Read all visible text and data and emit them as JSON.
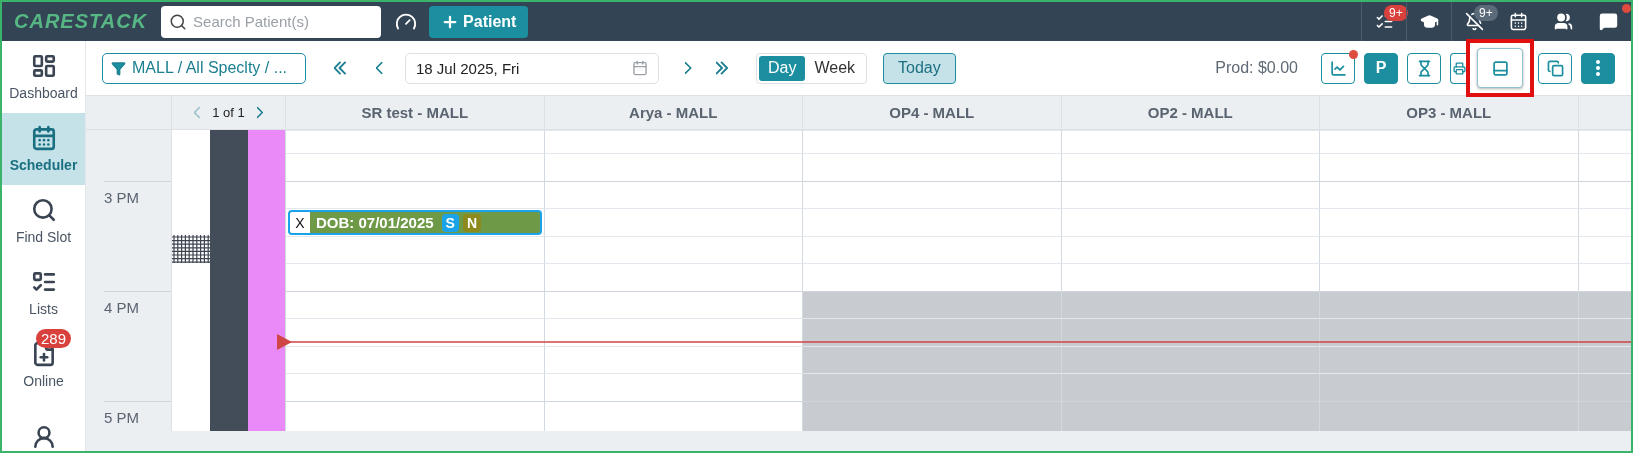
{
  "topbar": {
    "logo": "CARESTACK",
    "search": {
      "placeholder": "Search Patient(s)"
    },
    "add_patient": "Patient",
    "icons": [
      {
        "kind": "tasks",
        "badge": "9+",
        "color": "#d9413d"
      },
      {
        "kind": "learn"
      },
      {
        "kind": "bell-off",
        "badge": "9+",
        "color": "#5c6b7a"
      },
      {
        "kind": "calendar"
      },
      {
        "kind": "users"
      },
      {
        "kind": "chat",
        "dot": true
      }
    ]
  },
  "sidebar": {
    "items": [
      {
        "label": "Dashboard",
        "selected": false
      },
      {
        "label": "Scheduler",
        "selected": true
      },
      {
        "label": "Find Slot",
        "selected": false
      },
      {
        "label": "Lists",
        "selected": false
      },
      {
        "label": "Online",
        "selected": false,
        "badge": "289"
      },
      {
        "selected": false
      }
    ]
  },
  "toolbar": {
    "filter": "MALL / All Speclty / ...",
    "date": "18 Jul 2025, Fri",
    "views": [
      {
        "label": "Day",
        "selected": true
      },
      {
        "label": "Week",
        "selected": false
      }
    ],
    "today": "Today",
    "production": "Prod: $0.00",
    "actions": [
      {
        "kind": "chart",
        "filled": false,
        "dot": true
      },
      {
        "kind": "text",
        "text": "P",
        "filled": true
      },
      {
        "kind": "timer",
        "filled": false
      },
      {
        "kind": "print",
        "filled": false
      },
      {
        "kind": "layout",
        "filled": false,
        "highlighted": true
      },
      {
        "kind": "copy",
        "filled": false
      },
      {
        "kind": "more",
        "filled": true
      }
    ]
  },
  "calendar": {
    "pager": {
      "text": "1 of 1",
      "prev_disabled": true,
      "next_disabled": false
    },
    "columns": [
      {
        "name": "SR test - MALL"
      },
      {
        "name": "Arya - MALL"
      },
      {
        "name": "OP4 - MALL"
      },
      {
        "name": "OP2 - MALL"
      },
      {
        "name": "OP3 - MALL"
      },
      {}
    ],
    "slots": [
      {
        "hour_start": false,
        "cells": [
          {
            "blocked": false
          },
          {
            "blocked": false
          },
          {
            "blocked": false
          },
          {
            "blocked": false
          },
          {
            "blocked": false
          },
          {
            "blocked": false
          }
        ]
      },
      {
        "hour_start": false,
        "cells": [
          {
            "blocked": false
          },
          {
            "blocked": false
          },
          {
            "blocked": false
          },
          {
            "blocked": false
          },
          {
            "blocked": false
          },
          {
            "blocked": false
          }
        ]
      },
      {
        "label": "3 PM",
        "hour_start": true,
        "cells": [
          {
            "blocked": false
          },
          {
            "blocked": false
          },
          {
            "blocked": false
          },
          {
            "blocked": false
          },
          {
            "blocked": false
          },
          {
            "blocked": false
          }
        ]
      },
      {
        "hour_start": false,
        "cells": [
          {
            "blocked": false,
            "appointment": {
              "close": "X",
              "title": "DOB: 07/01/2025",
              "badges": [
                {
                  "text": "S",
                  "color": "#1aa3e8"
                },
                {
                  "text": "N",
                  "color": "#8c8a1c"
                }
              ]
            }
          },
          {
            "blocked": false
          },
          {
            "blocked": false
          },
          {
            "blocked": false
          },
          {
            "blocked": false
          },
          {
            "blocked": false
          }
        ]
      },
      {
        "hour_start": false,
        "cells": [
          {
            "blocked": false
          },
          {
            "blocked": false
          },
          {
            "blocked": false
          },
          {
            "blocked": false
          },
          {
            "blocked": false
          },
          {
            "blocked": false
          }
        ]
      },
      {
        "hour_start": false,
        "cells": [
          {
            "blocked": false
          },
          {
            "blocked": false
          },
          {
            "blocked": false
          },
          {
            "blocked": false
          },
          {
            "blocked": false
          },
          {
            "blocked": false
          }
        ]
      },
      {
        "label": "4 PM",
        "hour_start": true,
        "cells": [
          {
            "blocked": false
          },
          {
            "blocked": false
          },
          {
            "blocked": true
          },
          {
            "blocked": true
          },
          {
            "blocked": true
          },
          {
            "blocked": true
          }
        ]
      },
      {
        "hour_start": false,
        "now": true,
        "cells": [
          {
            "blocked": false
          },
          {
            "blocked": false
          },
          {
            "blocked": true
          },
          {
            "blocked": true
          },
          {
            "blocked": true
          },
          {
            "blocked": true
          }
        ]
      },
      {
        "hour_start": false,
        "cells": [
          {
            "blocked": false
          },
          {
            "blocked": false
          },
          {
            "blocked": true
          },
          {
            "blocked": true
          },
          {
            "blocked": true
          },
          {
            "blocked": true
          }
        ]
      },
      {
        "hour_start": false,
        "cells": [
          {
            "blocked": false
          },
          {
            "blocked": false
          },
          {
            "blocked": true
          },
          {
            "blocked": true
          },
          {
            "blocked": true
          },
          {
            "blocked": true
          }
        ]
      },
      {
        "label": "5 PM",
        "hour_start": true,
        "cells": [
          {
            "blocked": false
          },
          {
            "blocked": false
          },
          {
            "blocked": true
          },
          {
            "blocked": true
          },
          {
            "blocked": true
          },
          {
            "blocked": true
          }
        ]
      }
    ]
  }
}
